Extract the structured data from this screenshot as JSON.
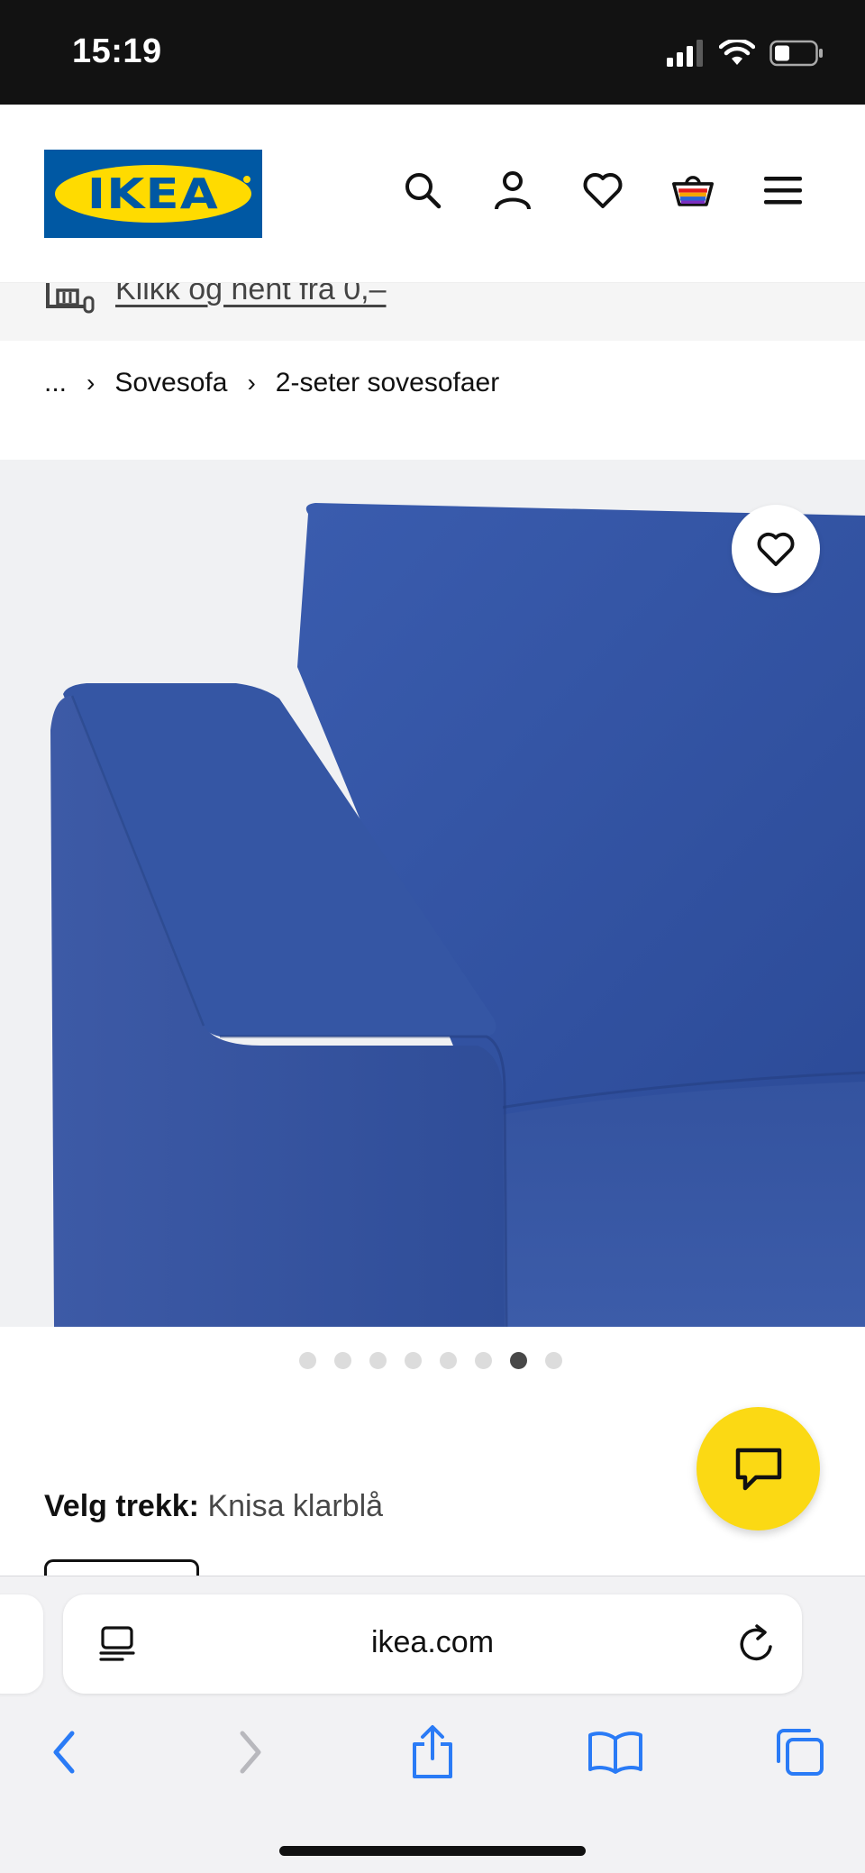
{
  "status_bar": {
    "time": "15:19"
  },
  "header": {
    "logo_text": "IKEA",
    "icons": [
      "search-icon",
      "account-icon",
      "heart-icon",
      "cart-icon",
      "menu-icon"
    ]
  },
  "promo": {
    "text": "Klikk og hent fra 0,–"
  },
  "breadcrumb": {
    "ellipsis": "...",
    "items": [
      "Sovesofa",
      "2-seter sovesofaer"
    ]
  },
  "product": {
    "image_alt": "Blue 2-seat sofa bed with Knisa klarblå cover",
    "carousel": {
      "count": 8,
      "active_index": 6
    }
  },
  "cover": {
    "label": "Velg trekk:",
    "value": "Knisa klarblå"
  },
  "browser": {
    "url": "ikea.com"
  },
  "colors": {
    "brand_blue": "#0058a3",
    "brand_yellow": "#ffdb00",
    "chat_yellow": "#fbd914",
    "sofa_blue": "#2f4f9a",
    "ios_blue": "#2a7bf6"
  }
}
